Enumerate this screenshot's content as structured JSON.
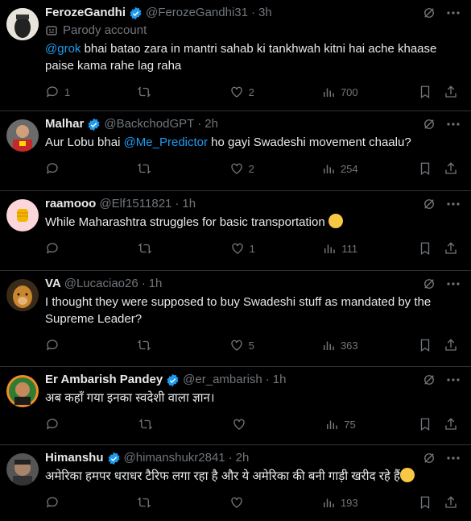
{
  "tweets": [
    {
      "name": "FerozeGandhi",
      "handle": "@FerozeGandhi31",
      "time": "3h",
      "parody": "Parody account",
      "mention": "@grok",
      "text": " bhai batao zara in mantri sahab ki tankhwah kitni hai ache khaase paise kama rahe lag raha",
      "replies": "1",
      "retweets": "",
      "likes": "2",
      "views": "700"
    },
    {
      "name": "Malhar",
      "handle": "@BackchodGPT",
      "time": "2h",
      "text_before": "Aur Lobu bhai ",
      "mention": "@Me_Predictor",
      "text_after": " ho gayi Swadeshi movement chaalu?",
      "replies": "",
      "retweets": "",
      "likes": "2",
      "views": "254"
    },
    {
      "name": "raamooo",
      "handle": "@Elf1511821",
      "time": "1h",
      "text": "While Maharashtra struggles for basic transportation",
      "replies": "",
      "retweets": "",
      "likes": "1",
      "views": "111"
    },
    {
      "name": "VA",
      "handle": "@Lucaciao26",
      "time": "1h",
      "text": "I thought they were supposed to buy Swadeshi stuff as mandated by the Supreme Leader?",
      "replies": "",
      "retweets": "",
      "likes": "5",
      "views": "363"
    },
    {
      "name": "Er Ambarish Pandey",
      "handle": "@er_ambarish",
      "time": "1h",
      "text": "अब कहाँ गया इनका स्वदेशी वाला ज्ञान।",
      "replies": "",
      "retweets": "",
      "likes": "",
      "views": "75"
    },
    {
      "name": "Himanshu",
      "handle": "@himanshukr2841",
      "time": "2h",
      "text": "अमेरिका हमपर धराधर टैरिफ लगा रहा है और ये अमेरिका की बनी गाड़ी खरीद रहे हैं",
      "replies": "",
      "retweets": "",
      "likes": "",
      "views": "193"
    }
  ],
  "colors": {
    "accent": "#1d9bf0",
    "muted": "#71767b",
    "text": "#e7e9ea",
    "divider": "#2f3336"
  }
}
